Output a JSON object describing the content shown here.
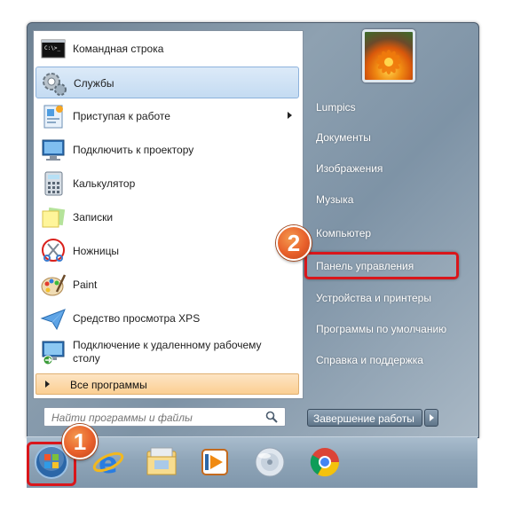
{
  "start_menu": {
    "programs": [
      {
        "label": "Командная строка",
        "icon": "cmd-icon"
      },
      {
        "label": "Службы",
        "icon": "services-icon"
      },
      {
        "label": "Приступая к работе",
        "icon": "getting-started-icon"
      },
      {
        "label": "Подключить к проектору",
        "icon": "projector-icon"
      },
      {
        "label": "Калькулятор",
        "icon": "calculator-icon"
      },
      {
        "label": "Записки",
        "icon": "sticky-notes-icon"
      },
      {
        "label": "Ножницы",
        "icon": "snipping-tool-icon"
      },
      {
        "label": "Paint",
        "icon": "paint-icon"
      },
      {
        "label": "Средство просмотра XPS",
        "icon": "xps-viewer-icon"
      },
      {
        "label": "Подключение к удаленному рабочему столу",
        "icon": "remote-desktop-icon"
      }
    ],
    "all_programs": "Все программы",
    "search_placeholder": "Найти программы и файлы",
    "right_items": [
      "Lumpics",
      "Документы",
      "Изображения",
      "Музыка",
      "Компьютер",
      "Панель управления",
      "Устройства и принтеры",
      "Программы по умолчанию",
      "Справка и поддержка"
    ],
    "shutdown_label": "Завершение работы"
  },
  "taskbar": {
    "items": [
      "start-orb-icon",
      "internet-explorer-icon",
      "file-explorer-icon",
      "media-player-icon",
      "disc-icon",
      "chrome-icon"
    ]
  },
  "annotations": {
    "step1": "1",
    "step2": "2",
    "highlight_color": "#d9161b",
    "badge_color": "#e8602b"
  }
}
